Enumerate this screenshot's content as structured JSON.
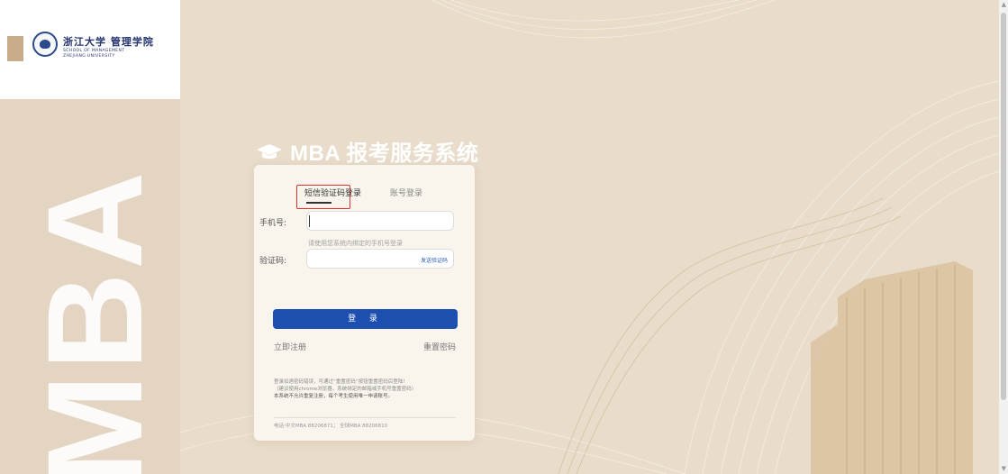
{
  "brand": {
    "logo_cn": "浙江大学 管理学院",
    "logo_en_line1": "SCHOOL OF MANAGEMENT",
    "logo_en_line2": "ZHEJIANG UNIVERSITY",
    "side_text": "MBA"
  },
  "title": {
    "text": "MBA 报考服务系统",
    "icon": "graduation-cap-icon"
  },
  "login": {
    "tabs": [
      {
        "label": "短信验证码登录",
        "active": true
      },
      {
        "label": "账号登录",
        "active": false
      }
    ],
    "phone_label": "手机号:",
    "phone_value": "",
    "phone_hint": "请使用您系统内绑定的手机号登录",
    "code_label": "验证码:",
    "code_value": "",
    "send_code_label": "发送验证码",
    "submit_label": "登 录",
    "register_label": "立即注册",
    "reset_label": "重置密码"
  },
  "notice": {
    "line1": "登录如遇密码错误，可通过“重置密码”按钮重置密码后登陆！",
    "line2": "（建议使用chrome浏览器，系统绑定的邮箱或手机号重置密码）",
    "line3": "本系统不允许重复注册，每个考生使用唯一申请账号。"
  },
  "contact": {
    "text": "电话:中文MBA 88206871；  全球MBA 88206810"
  },
  "colors": {
    "accent_blue": "#1d4fb1",
    "highlight_red": "#e03131",
    "background_gold": "#e4d5c2"
  }
}
